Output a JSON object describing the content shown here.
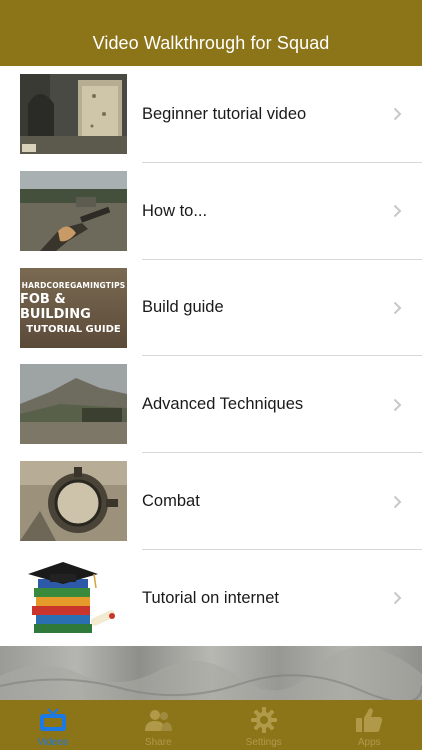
{
  "navbar": {
    "title": "Video Walkthrough for Squad"
  },
  "list": {
    "items": [
      {
        "label": "Beginner tutorial video",
        "thumb": "ruins-wall-thumbnail"
      },
      {
        "label": "How to...",
        "thumb": "rifle-field-thumbnail"
      },
      {
        "label": "Build guide",
        "thumb": "fob-building-guide-thumbnail",
        "thumb_text": [
          "HARDCOREGAMINGTIPS",
          "FOB & BUILDING",
          "TUTORIAL GUIDE"
        ]
      },
      {
        "label": "Advanced Techniques",
        "thumb": "hill-landscape-thumbnail"
      },
      {
        "label": "Combat",
        "thumb": "scope-sight-thumbnail"
      },
      {
        "label": "Tutorial on internet",
        "thumb": "books-graduation-cap-thumbnail"
      }
    ]
  },
  "tabbar": {
    "tabs": [
      {
        "label": "Videos",
        "icon": "tv-icon",
        "active": true
      },
      {
        "label": "Share",
        "icon": "people-icon",
        "active": false
      },
      {
        "label": "Settings",
        "icon": "gear-icon",
        "active": false
      },
      {
        "label": "Apps",
        "icon": "thumbs-up-icon",
        "active": false
      }
    ]
  },
  "colors": {
    "brand": "#8c7419",
    "active_tab": "#1b79e6",
    "inactive_tab": "#b09a4a"
  }
}
